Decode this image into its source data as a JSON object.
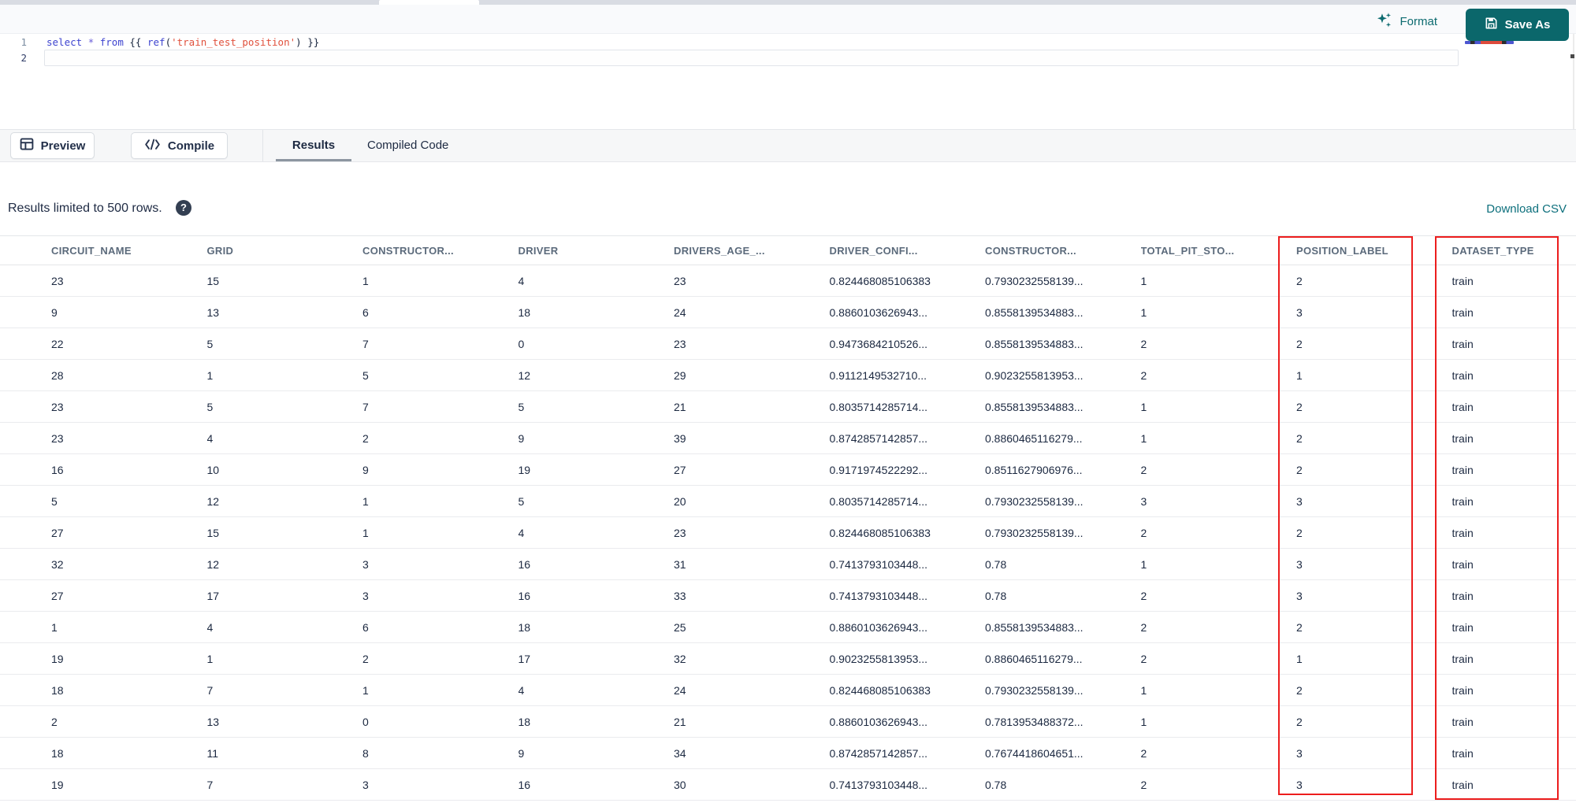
{
  "editor": {
    "line_numbers": [
      "1",
      "2"
    ],
    "code_tokens": [
      {
        "text": "select",
        "type": "keyword"
      },
      {
        "text": " ",
        "type": "plain"
      },
      {
        "text": "*",
        "type": "operator"
      },
      {
        "text": " ",
        "type": "plain"
      },
      {
        "text": "from",
        "type": "keyword"
      },
      {
        "text": " ",
        "type": "plain"
      },
      {
        "text": "{{",
        "type": "bracket"
      },
      {
        "text": " ",
        "type": "plain"
      },
      {
        "text": "ref",
        "type": "function"
      },
      {
        "text": "(",
        "type": "bracket"
      },
      {
        "text": "'train_test_position'",
        "type": "string"
      },
      {
        "text": ")",
        "type": "bracket"
      },
      {
        "text": " ",
        "type": "plain"
      },
      {
        "text": "}}",
        "type": "bracket"
      }
    ]
  },
  "header": {
    "format_label": "Format",
    "save_as_label": "Save As"
  },
  "toolbar": {
    "preview_label": "Preview",
    "compile_label": "Compile",
    "tabs": [
      {
        "label": "Results",
        "active": true
      },
      {
        "label": "Compiled Code",
        "active": false
      }
    ]
  },
  "status": {
    "limit_text": "Results limited to 500 rows.",
    "help_icon": "?",
    "download_label": "Download CSV"
  },
  "table": {
    "columns": [
      "CIRCUIT_NAME",
      "GRID",
      "CONSTRUCTOR...",
      "DRIVER",
      "DRIVERS_AGE_...",
      "DRIVER_CONFI...",
      "CONSTRUCTOR...",
      "TOTAL_PIT_STO...",
      "POSITION_LABEL",
      "DATASET_TYPE"
    ],
    "rows": [
      [
        "23",
        "15",
        "1",
        "4",
        "23",
        "0.824468085106383",
        "0.7930232558139...",
        "1",
        "2",
        "train"
      ],
      [
        "9",
        "13",
        "6",
        "18",
        "24",
        "0.8860103626943...",
        "0.8558139534883...",
        "1",
        "3",
        "train"
      ],
      [
        "22",
        "5",
        "7",
        "0",
        "23",
        "0.9473684210526...",
        "0.8558139534883...",
        "2",
        "2",
        "train"
      ],
      [
        "28",
        "1",
        "5",
        "12",
        "29",
        "0.9112149532710...",
        "0.9023255813953...",
        "2",
        "1",
        "train"
      ],
      [
        "23",
        "5",
        "7",
        "5",
        "21",
        "0.8035714285714...",
        "0.8558139534883...",
        "1",
        "2",
        "train"
      ],
      [
        "23",
        "4",
        "2",
        "9",
        "39",
        "0.8742857142857...",
        "0.8860465116279...",
        "1",
        "2",
        "train"
      ],
      [
        "16",
        "10",
        "9",
        "19",
        "27",
        "0.9171974522292...",
        "0.8511627906976...",
        "2",
        "2",
        "train"
      ],
      [
        "5",
        "12",
        "1",
        "5",
        "20",
        "0.8035714285714...",
        "0.7930232558139...",
        "3",
        "3",
        "train"
      ],
      [
        "27",
        "15",
        "1",
        "4",
        "23",
        "0.824468085106383",
        "0.7930232558139...",
        "2",
        "2",
        "train"
      ],
      [
        "32",
        "12",
        "3",
        "16",
        "31",
        "0.7413793103448...",
        "0.78",
        "1",
        "3",
        "train"
      ],
      [
        "27",
        "17",
        "3",
        "16",
        "33",
        "0.7413793103448...",
        "0.78",
        "2",
        "3",
        "train"
      ],
      [
        "1",
        "4",
        "6",
        "18",
        "25",
        "0.8860103626943...",
        "0.8558139534883...",
        "2",
        "2",
        "train"
      ],
      [
        "19",
        "1",
        "2",
        "17",
        "32",
        "0.9023255813953...",
        "0.8860465116279...",
        "2",
        "1",
        "train"
      ],
      [
        "18",
        "7",
        "1",
        "4",
        "24",
        "0.824468085106383",
        "0.7930232558139...",
        "1",
        "2",
        "train"
      ],
      [
        "2",
        "13",
        "0",
        "18",
        "21",
        "0.8860103626943...",
        "0.7813953488372...",
        "1",
        "2",
        "train"
      ],
      [
        "18",
        "11",
        "8",
        "9",
        "34",
        "0.8742857142857...",
        "0.7674418604651...",
        "2",
        "3",
        "train"
      ],
      [
        "19",
        "7",
        "3",
        "16",
        "30",
        "0.7413793103448...",
        "0.78",
        "2",
        "3",
        "train"
      ]
    ],
    "highlighted_columns": [
      "POSITION_LABEL",
      "DATASET_TYPE"
    ]
  },
  "colors": {
    "accent_teal": "#0d6b70",
    "save_button_teal": "#0b676b",
    "annotation_red": "#ec1d1d",
    "keyword_blue": "#3d43cf",
    "string_red": "#e0503c"
  }
}
